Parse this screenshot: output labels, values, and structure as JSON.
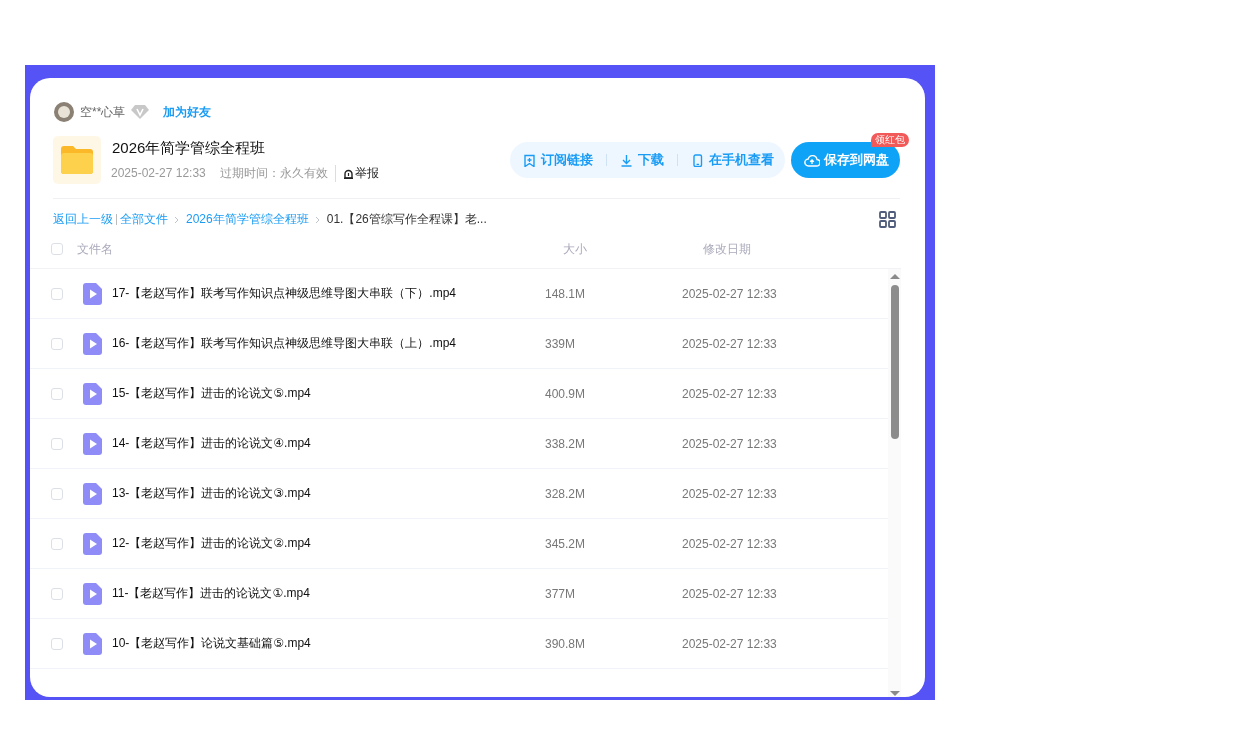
{
  "owner": {
    "name": "空**心草",
    "add_friend": "加为好友"
  },
  "share": {
    "title": "2026年简学管综全程班",
    "time": "2025-02-27 12:33",
    "expiry": "过期时间：永久有效",
    "report": "举报"
  },
  "actions": [
    {
      "kind": "subscribe",
      "label": "订阅链接"
    },
    {
      "kind": "download",
      "label": "下载"
    },
    {
      "kind": "phone",
      "label": "在手机查看"
    }
  ],
  "save_button": {
    "label": "保存到网盘",
    "badge": "领红包"
  },
  "breadcrumb": {
    "back": "返回上一级",
    "items": [
      "全部文件",
      "2026年简学管综全程班"
    ],
    "current": "01.【26管综写作全程课】老..."
  },
  "table": {
    "columns": [
      "文件名",
      "大小",
      "修改日期"
    ],
    "header_checked": false,
    "rows": [
      {
        "name": "17-【老赵写作】联考写作知识点神级思维导图大串联（下）.mp4",
        "size": "148.1M",
        "date": "2025-02-27 12:33",
        "checked": false
      },
      {
        "name": "16-【老赵写作】联考写作知识点神级思维导图大串联（上）.mp4",
        "size": "339M",
        "date": "2025-02-27 12:33",
        "checked": false
      },
      {
        "name": "15-【老赵写作】进击的论说文⑤.mp4",
        "size": "400.9M",
        "date": "2025-02-27 12:33",
        "checked": false
      },
      {
        "name": "14-【老赵写作】进击的论说文④.mp4",
        "size": "338.2M",
        "date": "2025-02-27 12:33",
        "checked": false
      },
      {
        "name": "13-【老赵写作】进击的论说文③.mp4",
        "size": "328.2M",
        "date": "2025-02-27 12:33",
        "checked": false
      },
      {
        "name": "12-【老赵写作】进击的论说文②.mp4",
        "size": "345.2M",
        "date": "2025-02-27 12:33",
        "checked": false
      },
      {
        "name": "11-【老赵写作】进击的论说文①.mp4",
        "size": "377M",
        "date": "2025-02-27 12:33",
        "checked": false
      },
      {
        "name": "10-【老赵写作】论说文基础篇⑤.mp4",
        "size": "390.8M",
        "date": "2025-02-27 12:33",
        "checked": false
      }
    ]
  }
}
